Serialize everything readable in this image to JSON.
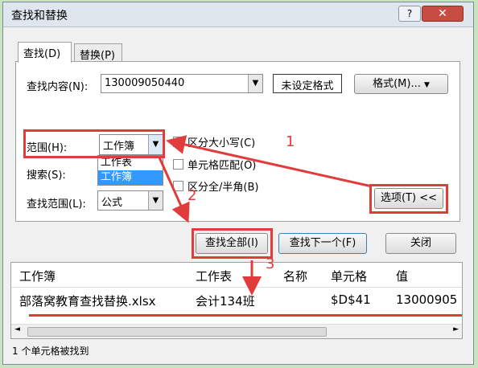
{
  "window": {
    "title": "查找和替换",
    "help_label": "?",
    "close_label": "✕"
  },
  "tabs": [
    {
      "label": "查找(D)"
    },
    {
      "label": "替换(P)"
    }
  ],
  "find": {
    "content_label": "查找内容(N):",
    "content_value": "130009050440",
    "format_status": "未设定格式",
    "format_button": "格式(M)...",
    "scope_label": "范围(H):",
    "scope_value": "工作簿",
    "scope_options": [
      "工作表",
      "工作簿"
    ],
    "search_label": "搜索(S):",
    "lookin_label": "查找范围(L):",
    "lookin_value": "公式",
    "match_case": "区分大小写(C)",
    "match_cell": "单元格匹配(O)",
    "match_width": "区分全/半角(B)",
    "options_button": "选项(T) <<"
  },
  "buttons": {
    "find_all": "查找全部(I)",
    "find_next": "查找下一个(F)",
    "close": "关闭"
  },
  "results": {
    "columns": [
      "工作簿",
      "工作表",
      "名称",
      "单元格",
      "值"
    ],
    "rows": [
      {
        "workbook": "部落窝教育查找替换.xlsx",
        "sheet": "会计134班",
        "name": "",
        "cell": "$D$41",
        "value": "13000905"
      }
    ]
  },
  "status": "1 个单元格被找到",
  "annotations": [
    "1",
    "2",
    "3"
  ],
  "colors": {
    "highlight": "#e13b3b",
    "selection": "#3399ff"
  }
}
